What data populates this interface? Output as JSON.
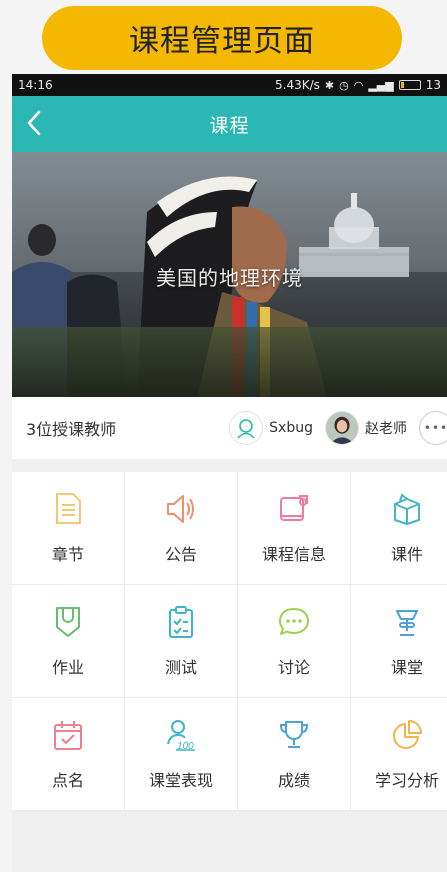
{
  "banner": {
    "title": "课程管理页面"
  },
  "statusbar": {
    "time": "14:16",
    "speed": "5.43K/s",
    "battery": "13"
  },
  "navbar": {
    "title": "课程"
  },
  "hero": {
    "title": "美国的地理环境"
  },
  "teachers": {
    "count_label": "3位授课教师",
    "list": [
      {
        "name": "Sxbug"
      },
      {
        "name": "赵老师"
      }
    ]
  },
  "grid": [
    {
      "label": "章节",
      "icon": "chapter-icon",
      "color": "#f3c77a"
    },
    {
      "label": "公告",
      "icon": "announcement-icon",
      "color": "#ef8f70"
    },
    {
      "label": "课程信息",
      "icon": "course-info-icon",
      "color": "#f07aa0"
    },
    {
      "label": "课件",
      "icon": "courseware-icon",
      "color": "#44b6c4"
    },
    {
      "label": "作业",
      "icon": "homework-icon",
      "color": "#69be6b"
    },
    {
      "label": "测试",
      "icon": "test-icon",
      "color": "#3bb6c6"
    },
    {
      "label": "讨论",
      "icon": "discussion-icon",
      "color": "#9fd04c"
    },
    {
      "label": "课堂",
      "icon": "classroom-icon",
      "color": "#4aa4d8"
    },
    {
      "label": "点名",
      "icon": "rollcall-icon",
      "color": "#ef7e8e"
    },
    {
      "label": "课堂表现",
      "icon": "performance-icon",
      "color": "#3bb6c6"
    },
    {
      "label": "成绩",
      "icon": "grades-icon",
      "color": "#4aa4d8"
    },
    {
      "label": "学习分析",
      "icon": "analysis-icon",
      "color": "#f0b44a"
    }
  ]
}
